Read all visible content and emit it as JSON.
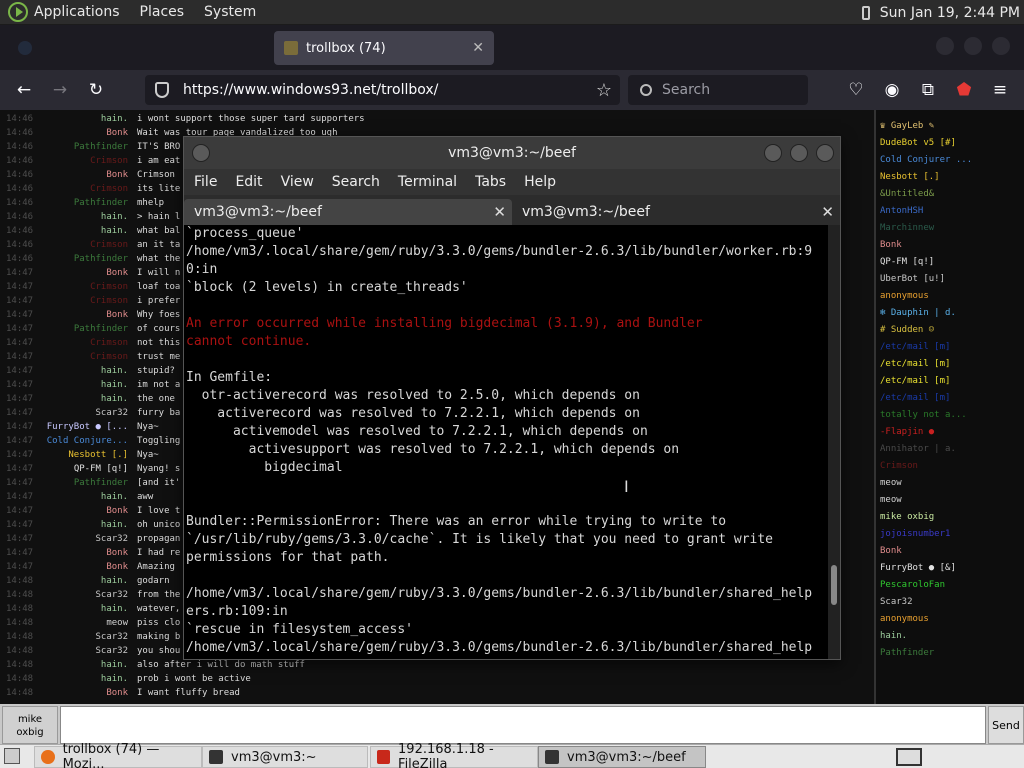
{
  "panel": {
    "menus": [
      "Applications",
      "Places",
      "System"
    ],
    "clock": "Sun Jan 19,  2:44 PM"
  },
  "browser": {
    "tabs": [
      {
        "label": "trollbox (74)"
      }
    ],
    "url": "https://www.windows93.net/trollbox/",
    "search_placeholder": "Search"
  },
  "chat": {
    "rows": [
      {
        "time": "14:46",
        "user": "hain.",
        "color": "#9ccc9c",
        "msg": "i wont support those super tard supporters"
      },
      {
        "time": "14:46",
        "user": "Bonk",
        "color": "#e08c8c",
        "msg": "Wait was tour page vandalized too ugh"
      },
      {
        "time": "14:46",
        "user": "Pathfinder",
        "color": "#3c7a3c",
        "msg": "IT'S BRO"
      },
      {
        "time": "14:46",
        "user": "Crimson",
        "color": "#6a1a1a",
        "msg": "i am eat"
      },
      {
        "time": "14:46",
        "user": "Bonk",
        "color": "#e08c8c",
        "msg": "Crimson"
      },
      {
        "time": "14:46",
        "user": "Crimson",
        "color": "#6a1a1a",
        "msg": "its lite"
      },
      {
        "time": "14:46",
        "user": "Pathfinder",
        "color": "#3c7a3c",
        "msg": "mhelp"
      },
      {
        "time": "14:46",
        "user": "hain.",
        "color": "#9ccc9c",
        "msg": "> hain l"
      },
      {
        "time": "14:46",
        "user": "hain.",
        "color": "#9ccc9c",
        "msg": "what bal"
      },
      {
        "time": "14:46",
        "user": "Crimson",
        "color": "#6a1a1a",
        "msg": "an it ta"
      },
      {
        "time": "14:46",
        "user": "Pathfinder",
        "color": "#3c7a3c",
        "msg": "what the"
      },
      {
        "time": "14:47",
        "user": "Bonk",
        "color": "#e08c8c",
        "msg": "I will n"
      },
      {
        "time": "14:47",
        "user": "Crimson",
        "color": "#6a1a1a",
        "msg": "loaf toa"
      },
      {
        "time": "14:47",
        "user": "Crimson",
        "color": "#6a1a1a",
        "msg": "i prefer"
      },
      {
        "time": "14:47",
        "user": "Bonk",
        "color": "#e08c8c",
        "msg": "Why foes"
      },
      {
        "time": "14:47",
        "user": "Pathfinder",
        "color": "#3c7a3c",
        "msg": "of cours"
      },
      {
        "time": "14:47",
        "user": "Crimson",
        "color": "#6a1a1a",
        "msg": "not this"
      },
      {
        "time": "14:47",
        "user": "Crimson",
        "color": "#6a1a1a",
        "msg": "trust me"
      },
      {
        "time": "14:47",
        "user": "hain.",
        "color": "#9ccc9c",
        "msg": "stupid?"
      },
      {
        "time": "14:47",
        "user": "hain.",
        "color": "#9ccc9c",
        "msg": "im not a"
      },
      {
        "time": "14:47",
        "user": "hain.",
        "color": "#9ccc9c",
        "msg": "the one"
      },
      {
        "time": "14:47",
        "user": "Scar32",
        "color": "#c8c8c8",
        "msg": "furry ba"
      },
      {
        "time": "14:47",
        "user": "FurryBot ● [...",
        "color": "#c8c8ff",
        "msg": "Nya~"
      },
      {
        "time": "14:47",
        "user": "Cold Conjure...",
        "color": "#4a8ad8",
        "msg": "Toggling"
      },
      {
        "time": "14:47",
        "user": "Nesbott [.]",
        "color": "#e8c030",
        "msg": "Nya~"
      },
      {
        "time": "14:47",
        "user": "QP-FM [q!]",
        "color": "#e0e0e0",
        "msg": "Nyang! s"
      },
      {
        "time": "14:47",
        "user": "Pathfinder",
        "color": "#3c7a3c",
        "msg": "[and it'"
      },
      {
        "time": "14:47",
        "user": "hain.",
        "color": "#9ccc9c",
        "msg": "aww"
      },
      {
        "time": "14:47",
        "user": "Bonk",
        "color": "#e08c8c",
        "msg": "I love t"
      },
      {
        "time": "14:47",
        "user": "hain.",
        "color": "#9ccc9c",
        "msg": "oh unico"
      },
      {
        "time": "14:47",
        "user": "Scar32",
        "color": "#c8c8c8",
        "msg": "propagan"
      },
      {
        "time": "14:47",
        "user": "Bonk",
        "color": "#e08c8c",
        "msg": "I had re"
      },
      {
        "time": "14:47",
        "user": "Bonk",
        "color": "#e08c8c",
        "msg": "Amazing"
      },
      {
        "time": "14:48",
        "user": "hain.",
        "color": "#9ccc9c",
        "msg": "godarn"
      },
      {
        "time": "14:48",
        "user": "Scar32",
        "color": "#c8c8c8",
        "msg": "from the"
      },
      {
        "time": "14:48",
        "user": "hain.",
        "color": "#9ccc9c",
        "msg": "watever,"
      },
      {
        "time": "14:48",
        "user": "meow",
        "color": "#d0d0d0",
        "msg": "piss clo"
      },
      {
        "time": "14:48",
        "user": "Scar32",
        "color": "#c8c8c8",
        "msg": "making b"
      },
      {
        "time": "14:48",
        "user": "Scar32",
        "color": "#c8c8c8",
        "msg": "you shou"
      },
      {
        "time": "14:48",
        "user": "hain.",
        "color": "#9ccc9c",
        "msg": "also after i will do math stuff"
      },
      {
        "time": "14:48",
        "user": "hain.",
        "color": "#9ccc9c",
        "msg": "prob i wont be active"
      },
      {
        "time": "14:48",
        "user": "Bonk",
        "color": "#e08c8c",
        "msg": "I want fluffy bread"
      }
    ]
  },
  "userlist": [
    {
      "name": "♛ GayLeb ✎",
      "color": "#e0c070"
    },
    {
      "name": "DudeBot v5 [#]",
      "color": "#e8d030"
    },
    {
      "name": "Cold Conjurer ...",
      "color": "#4a8ad8"
    },
    {
      "name": "Nesbott [.]",
      "color": "#e8c030"
    },
    {
      "name": "&Untitled&",
      "color": "#7a9a4a"
    },
    {
      "name": "AntonHSH",
      "color": "#3a6ac8"
    },
    {
      "name": "Marchinnew",
      "color": "#2a5a4a"
    },
    {
      "name": "Bonk",
      "color": "#e08c8c"
    },
    {
      "name": "QP-FM [q!]",
      "color": "#e0e0e0"
    },
    {
      "name": "UberBot [u!]",
      "color": "#c8c8c8"
    },
    {
      "name": "anonymous",
      "color": "#e8a030"
    },
    {
      "name": "❄ Dauphin | d.",
      "color": "#5ab0e8"
    },
    {
      "name": "# Sudden ☺",
      "color": "#d8c040"
    },
    {
      "name": "/etc/mail [m]",
      "color": "#1a3aa8"
    },
    {
      "name": "/etc/mail [m]",
      "color": "#e8e030"
    },
    {
      "name": "/etc/mail [m]",
      "color": "#e8e030"
    },
    {
      "name": "/etc/mail [m]",
      "color": "#1a3aa8"
    },
    {
      "name": "totally not a...",
      "color": "#2a7a2a"
    },
    {
      "name": "-Flapjin ●",
      "color": "#c82020"
    },
    {
      "name": "Annihator | a.",
      "color": "#4a4a4a"
    },
    {
      "name": "Crimson",
      "color": "#6a1a1a"
    },
    {
      "name": "meow",
      "color": "#d0d0d0"
    },
    {
      "name": "meow",
      "color": "#d0d0d0"
    },
    {
      "name": "mike oxbig",
      "color": "#c8e8a0"
    },
    {
      "name": "jojoisnumber1",
      "color": "#3a3ac8"
    },
    {
      "name": "Bonk",
      "color": "#e08c8c"
    },
    {
      "name": "FurryBot ● [&]",
      "color": "#e0e0e0"
    },
    {
      "name": "PescaroloFan",
      "color": "#30c830"
    },
    {
      "name": "Scar32",
      "color": "#c8c8c8"
    },
    {
      "name": "anonymous",
      "color": "#e8a030"
    },
    {
      "name": "hain.",
      "color": "#9ccc9c"
    },
    {
      "name": "Pathfinder",
      "color": "#3c7a3c"
    }
  ],
  "input": {
    "nick_line1": "mike",
    "nick_line2": "oxbig",
    "send_label": "Send"
  },
  "taskbar": [
    {
      "label": "trollbox (74) — Mozi...",
      "icon_color": "#e8701a"
    },
    {
      "label": "vm3@vm3:~",
      "icon_color": "#333333"
    },
    {
      "label": "192.168.1.18 - FileZilla",
      "icon_color": "#c8281a"
    },
    {
      "label": "vm3@vm3:~/beef",
      "icon_color": "#333333"
    }
  ],
  "terminal": {
    "title": "vm3@vm3:~/beef",
    "menu": [
      "File",
      "Edit",
      "View",
      "Search",
      "Terminal",
      "Tabs",
      "Help"
    ],
    "tabs": [
      "vm3@vm3:~/beef",
      "vm3@vm3:~/beef"
    ],
    "lines": [
      {
        "text": "`process_queue'",
        "err": false
      },
      {
        "text": "/home/vm3/.local/share/gem/ruby/3.3.0/gems/bundler-2.6.3/lib/bundler/worker.rb:9",
        "err": false
      },
      {
        "text": "0:in",
        "err": false
      },
      {
        "text": "`block (2 levels) in create_threads'",
        "err": false
      },
      {
        "text": "",
        "err": false
      },
      {
        "text": "An error occurred while installing bigdecimal (3.1.9), and Bundler",
        "err": true
      },
      {
        "text": "cannot continue.",
        "err": true
      },
      {
        "text": "",
        "err": false
      },
      {
        "text": "In Gemfile:",
        "err": false
      },
      {
        "text": "  otr-activerecord was resolved to 2.5.0, which depends on",
        "err": false
      },
      {
        "text": "    activerecord was resolved to 7.2.2.1, which depends on",
        "err": false
      },
      {
        "text": "      activemodel was resolved to 7.2.2.1, which depends on",
        "err": false
      },
      {
        "text": "        activesupport was resolved to 7.2.2.1, which depends on",
        "err": false
      },
      {
        "text": "          bigdecimal",
        "err": false
      },
      {
        "text": "",
        "err": false
      },
      {
        "text": "",
        "err": false
      },
      {
        "text": "Bundler::PermissionError: There was an error while trying to write to",
        "err": false
      },
      {
        "text": "`/usr/lib/ruby/gems/3.3.0/cache`. It is likely that you need to grant write",
        "err": false
      },
      {
        "text": "permissions for that path.",
        "err": false
      },
      {
        "text": "",
        "err": false
      },
      {
        "text": "/home/vm3/.local/share/gem/ruby/3.3.0/gems/bundler-2.6.3/lib/bundler/shared_help",
        "err": false
      },
      {
        "text": "ers.rb:109:in",
        "err": false
      },
      {
        "text": "`rescue in filesystem_access'",
        "err": false
      },
      {
        "text": "/home/vm3/.local/share/gem/ruby/3.3.0/gems/bundler-2.6.3/lib/bundler/shared_help",
        "err": false
      }
    ]
  }
}
